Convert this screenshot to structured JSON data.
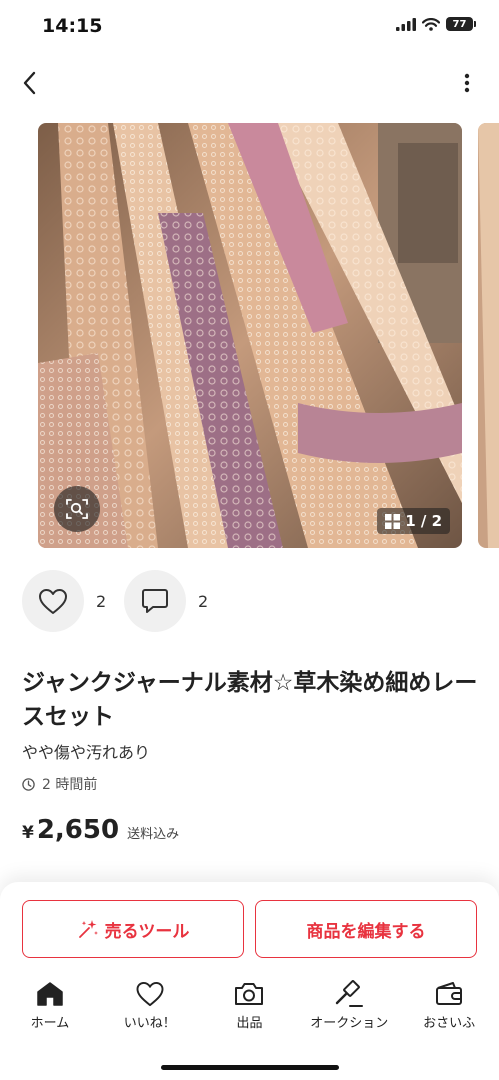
{
  "status_bar": {
    "time": "14:15",
    "battery": "77"
  },
  "gallery": {
    "counter": "1 / 2"
  },
  "actions": {
    "likes": "2",
    "comments": "2"
  },
  "item": {
    "title": "ジャンクジャーナル素材☆草木染め細めレースセット",
    "condition": "やや傷や汚れあり",
    "posted": "2 時間前",
    "currency": "¥",
    "price": "2,650",
    "shipping": "送料込み"
  },
  "buttons": {
    "sell_tool": "売るツール",
    "edit_item": "商品を編集する"
  },
  "tabs": [
    {
      "label": "ホーム",
      "icon": "home-icon"
    },
    {
      "label": "いいね！",
      "icon": "heart-icon"
    },
    {
      "label": "出品",
      "icon": "camera-icon"
    },
    {
      "label": "オークション",
      "icon": "gavel-icon"
    },
    {
      "label": "おさいふ",
      "icon": "wallet-icon"
    }
  ],
  "colors": {
    "accent": "#e8333f",
    "text": "#222222",
    "muted": "#555555",
    "circle_bg": "#f0f0f0"
  }
}
